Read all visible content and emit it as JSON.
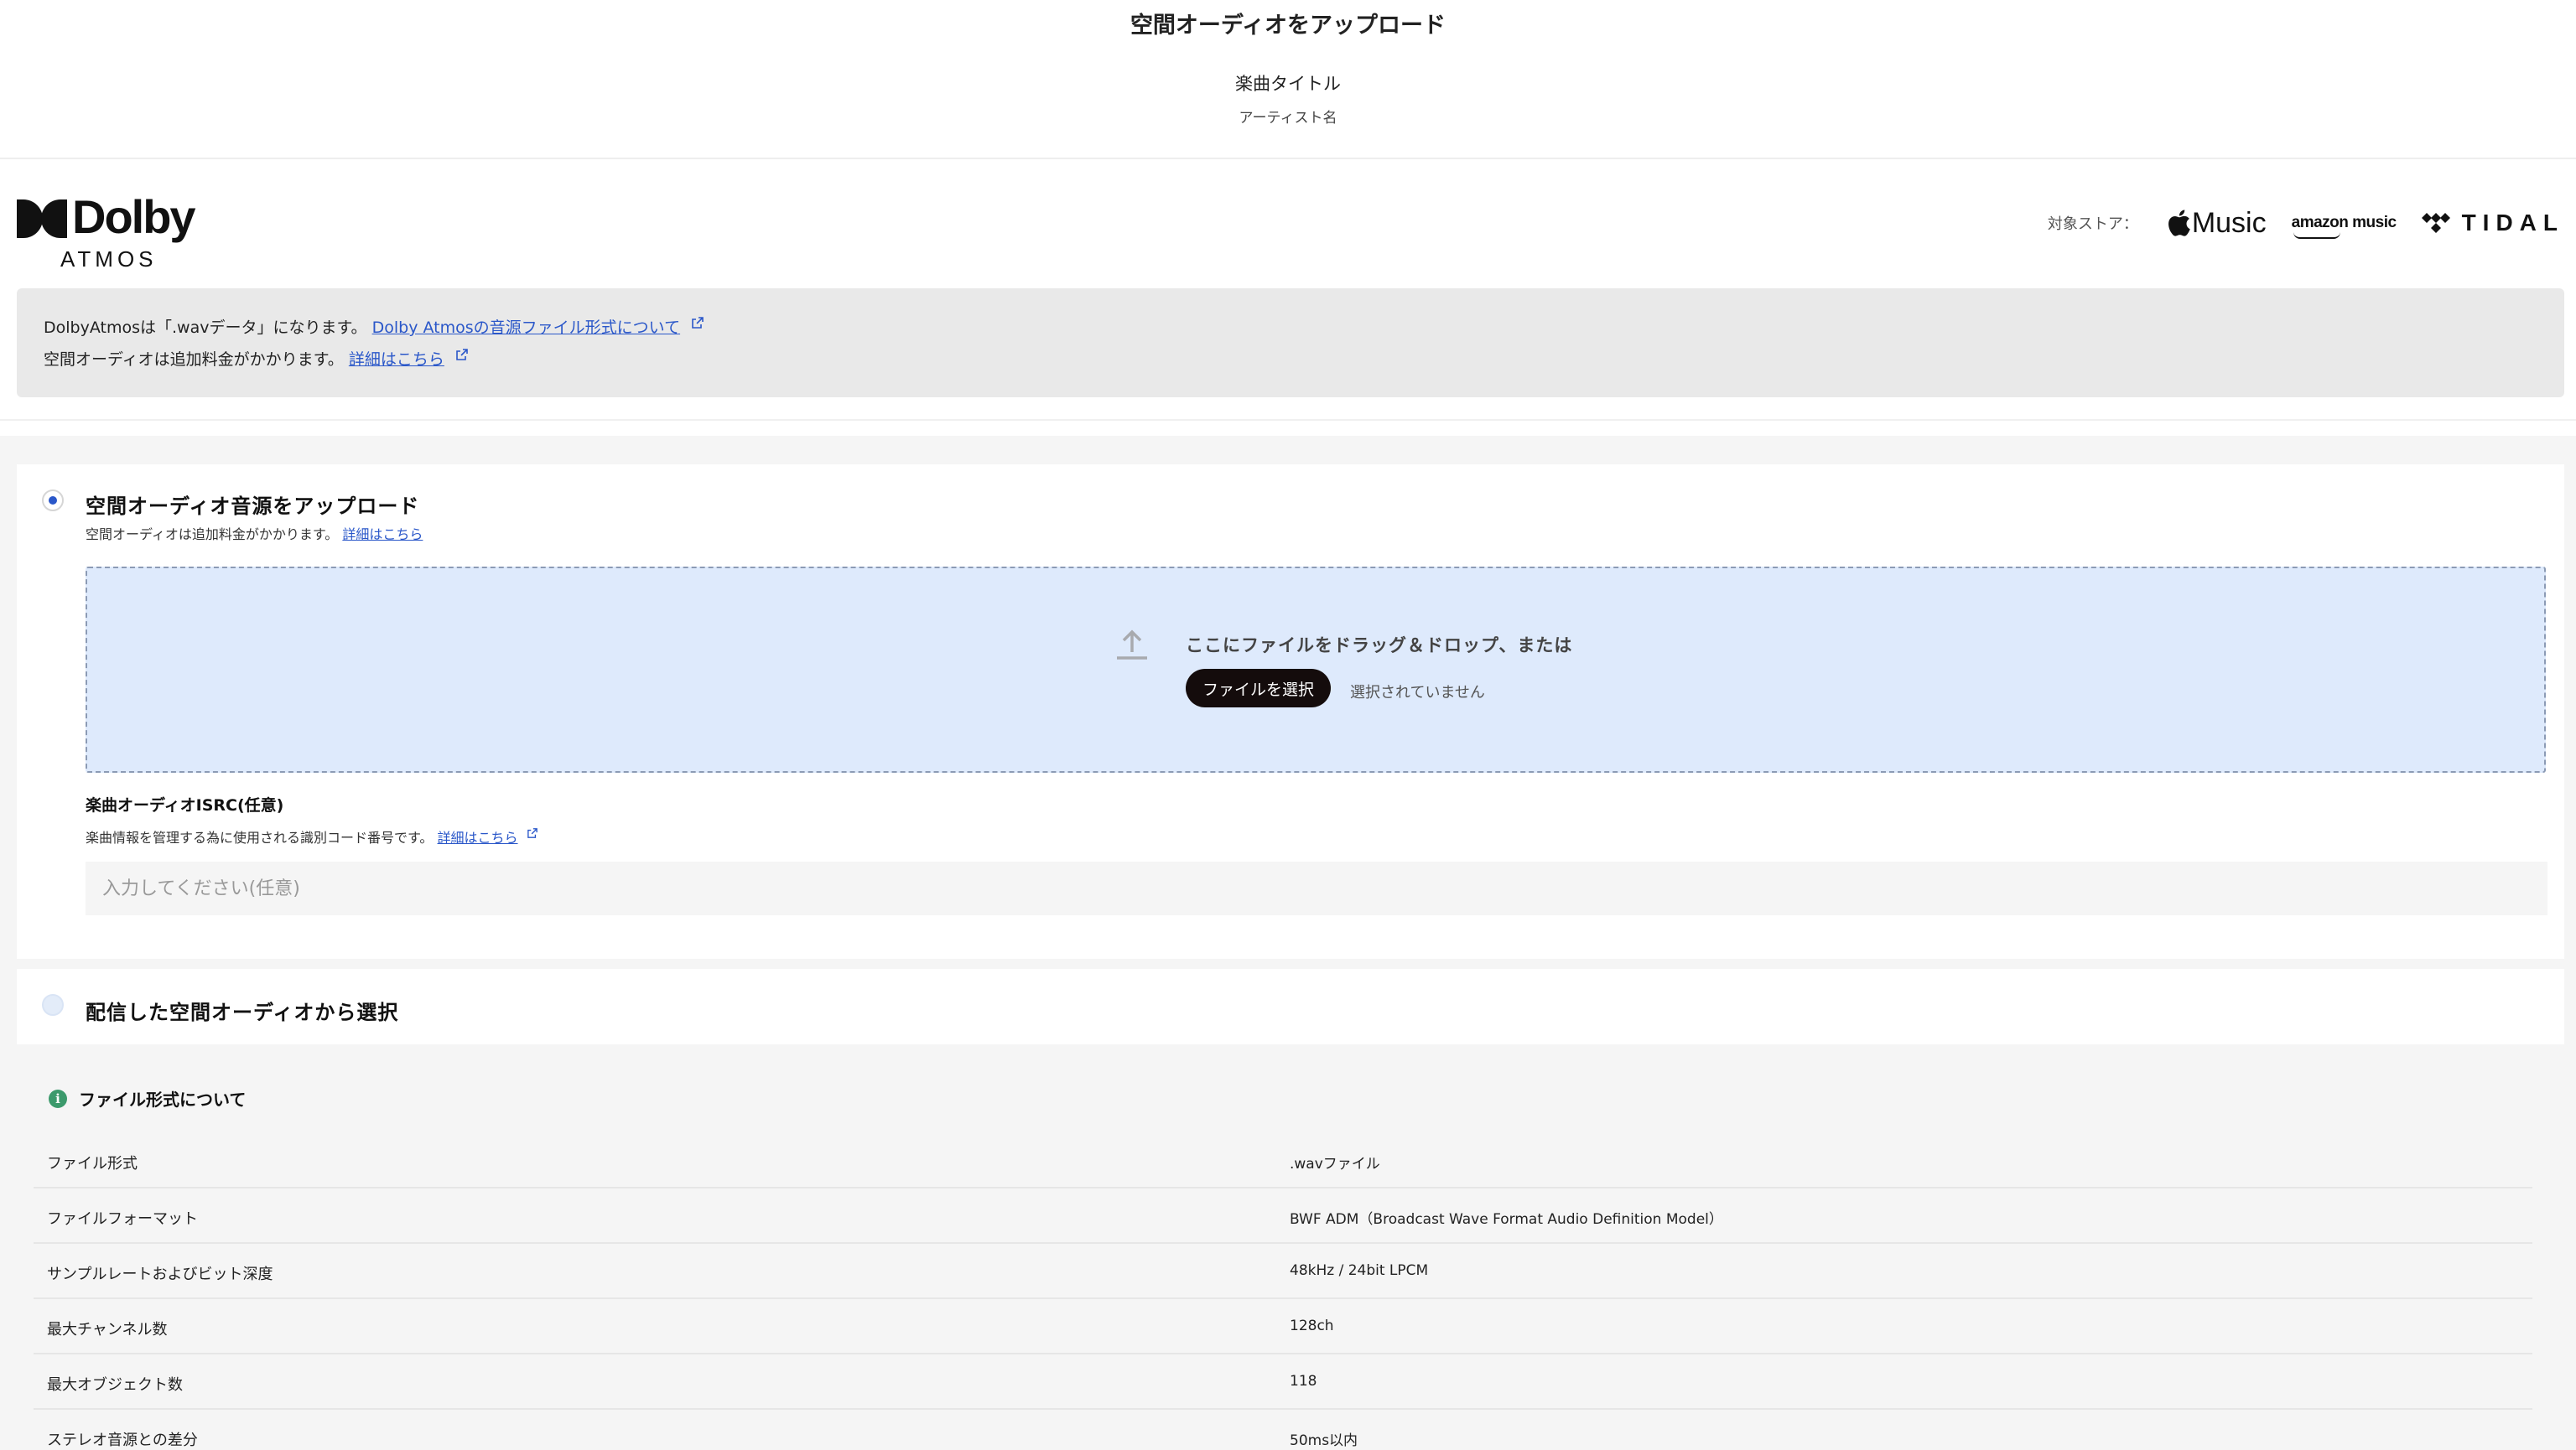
{
  "header": {
    "page_title": "空間オーディオをアップロード",
    "song_title": "楽曲タイトル",
    "artist_name": "アーティスト名"
  },
  "brand": {
    "logo_word": "Dolby",
    "logo_sub": "ATMOS",
    "stores_label": "対象ストア：",
    "stores": {
      "apple": "Music",
      "amazon": "amazon music",
      "tidal": "TIDAL"
    }
  },
  "notice": {
    "line1_text": "DolbyAtmosは「.wavデータ」になります。",
    "line1_link": "Dolby Atmosの音源ファイル形式について",
    "line2_text": "空間オーディオは追加料金がかかります。",
    "line2_link": "詳細はこちら"
  },
  "option_upload": {
    "title": "空間オーディオ音源をアップロード",
    "subtitle": "空間オーディオは追加料金がかかります。",
    "subtitle_link": "詳細はこちら",
    "selected": true,
    "dropzone": {
      "text": "ここにファイルをドラッグ＆ドロップ、または",
      "button_label": "ファイルを選択",
      "no_file_text": "選択されていません"
    },
    "isrc": {
      "label": "楽曲オーディオISRC(任意)",
      "help": "楽曲情報を管理する為に使用される識別コード番号です。",
      "help_link": "詳細はこちら",
      "placeholder": "入力してください(任意)",
      "value": ""
    }
  },
  "option_existing": {
    "title": "配信した空間オーディオから選択",
    "selected": false
  },
  "file_format": {
    "title": "ファイル形式について",
    "rows": [
      {
        "key": "ファイル形式",
        "value": ".wavファイル"
      },
      {
        "key": "ファイルフォーマット",
        "value": "BWF ADM（Broadcast Wave Format Audio Definition Model）"
      },
      {
        "key": "サンプルレートおよびビット深度",
        "value": "48kHz / 24bit LPCM"
      },
      {
        "key": "最大チャンネル数",
        "value": "128ch"
      },
      {
        "key": "最大オブジェクト数",
        "value": "118"
      },
      {
        "key": "ステレオ音源との差分",
        "value": "50ms以内"
      }
    ]
  },
  "colors": {
    "link": "#2a57c9",
    "dropzone_bg": "#deeafc",
    "button_bg": "#140c0c",
    "info_icon": "#3c9a6c",
    "radio_selected": "#2a57c9"
  }
}
